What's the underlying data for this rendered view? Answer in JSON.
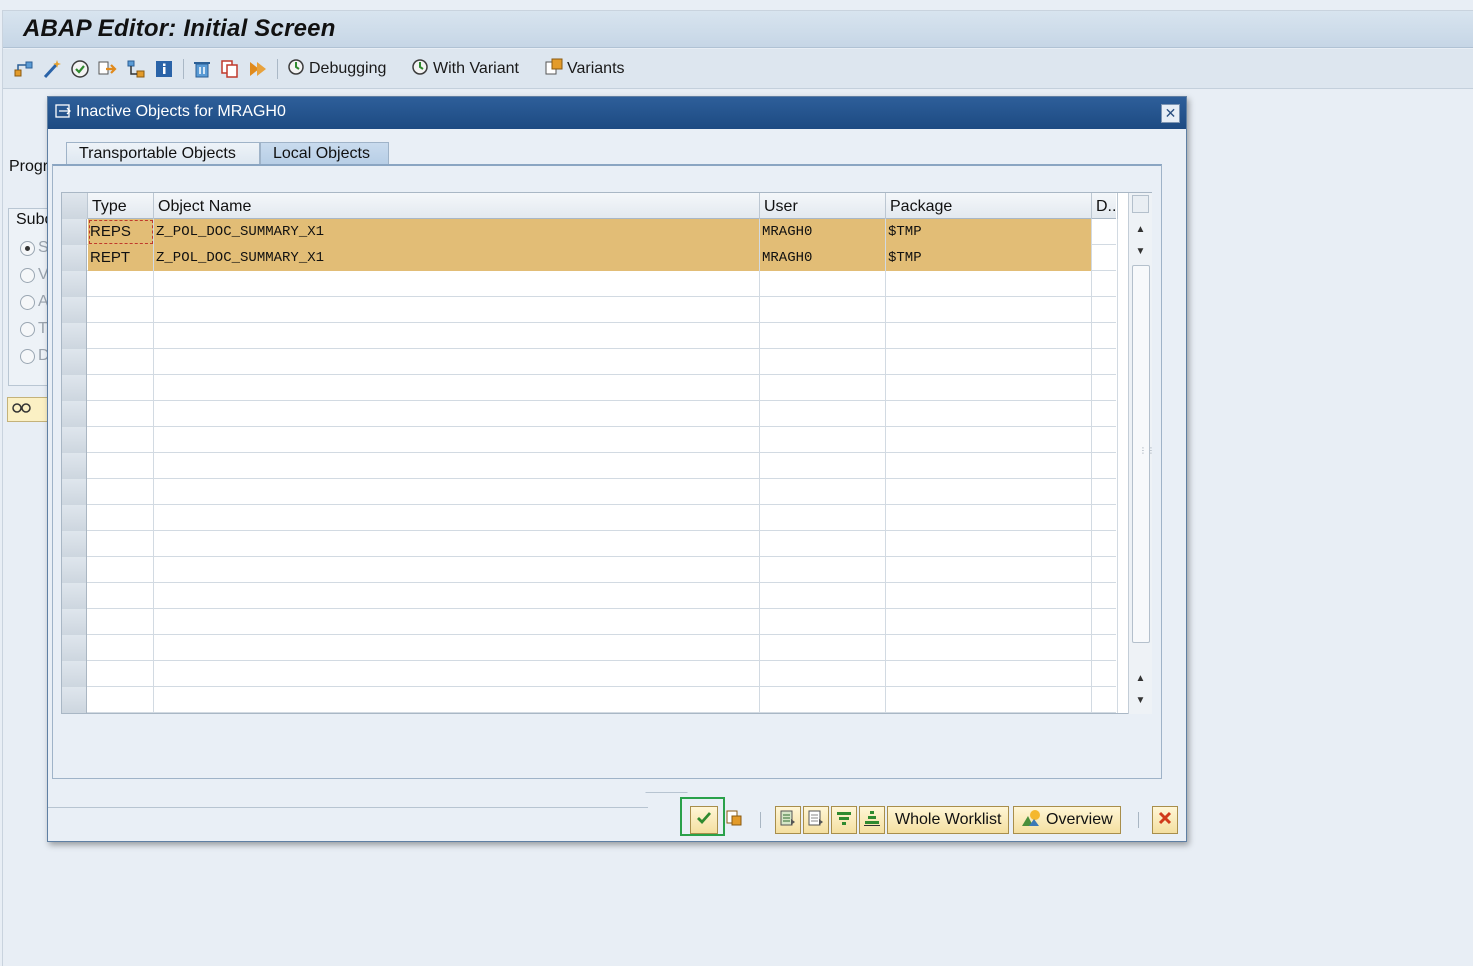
{
  "window": {
    "title": "ABAP Editor: Initial Screen"
  },
  "toolbar": {
    "icons": [
      "hierarchy-icon",
      "magic-wand-icon",
      "check-icon",
      "activate-icon",
      "where-used-icon",
      "info-icon",
      "delete-icon",
      "copy-icon",
      "execute-icon"
    ],
    "buttons": [
      {
        "label": "Debugging",
        "icon": "debug-icon"
      },
      {
        "label": "With Variant",
        "icon": "debug-variant-icon"
      },
      {
        "label": "Variants",
        "icon": "variants-icon"
      }
    ]
  },
  "background": {
    "program_label": "Progr",
    "subobjects_label": "Subc",
    "radio_letters": [
      "S",
      "V",
      "A",
      "T",
      "D"
    ]
  },
  "dialog": {
    "title": "Inactive Objects for MRAGH0",
    "tabs": [
      "Transportable Objects",
      "Local Objects"
    ],
    "active_tab": "Local Objects",
    "table": {
      "columns": [
        "Type",
        "Object Name",
        "User",
        "Package",
        "D.."
      ],
      "rows": [
        {
          "type": "REPS",
          "object_name": "Z_POL_DOC_SUMMARY_X1",
          "user": "MRAGH0",
          "package": "$TMP",
          "d": ""
        },
        {
          "type": "REPT",
          "object_name": "Z_POL_DOC_SUMMARY_X1",
          "user": "MRAGH0",
          "package": "$TMP",
          "d": ""
        }
      ],
      "highlight_color": "#e2bd76"
    },
    "footer": {
      "whole_worklist_label": "Whole Worklist",
      "overview_label": "Overview"
    }
  }
}
